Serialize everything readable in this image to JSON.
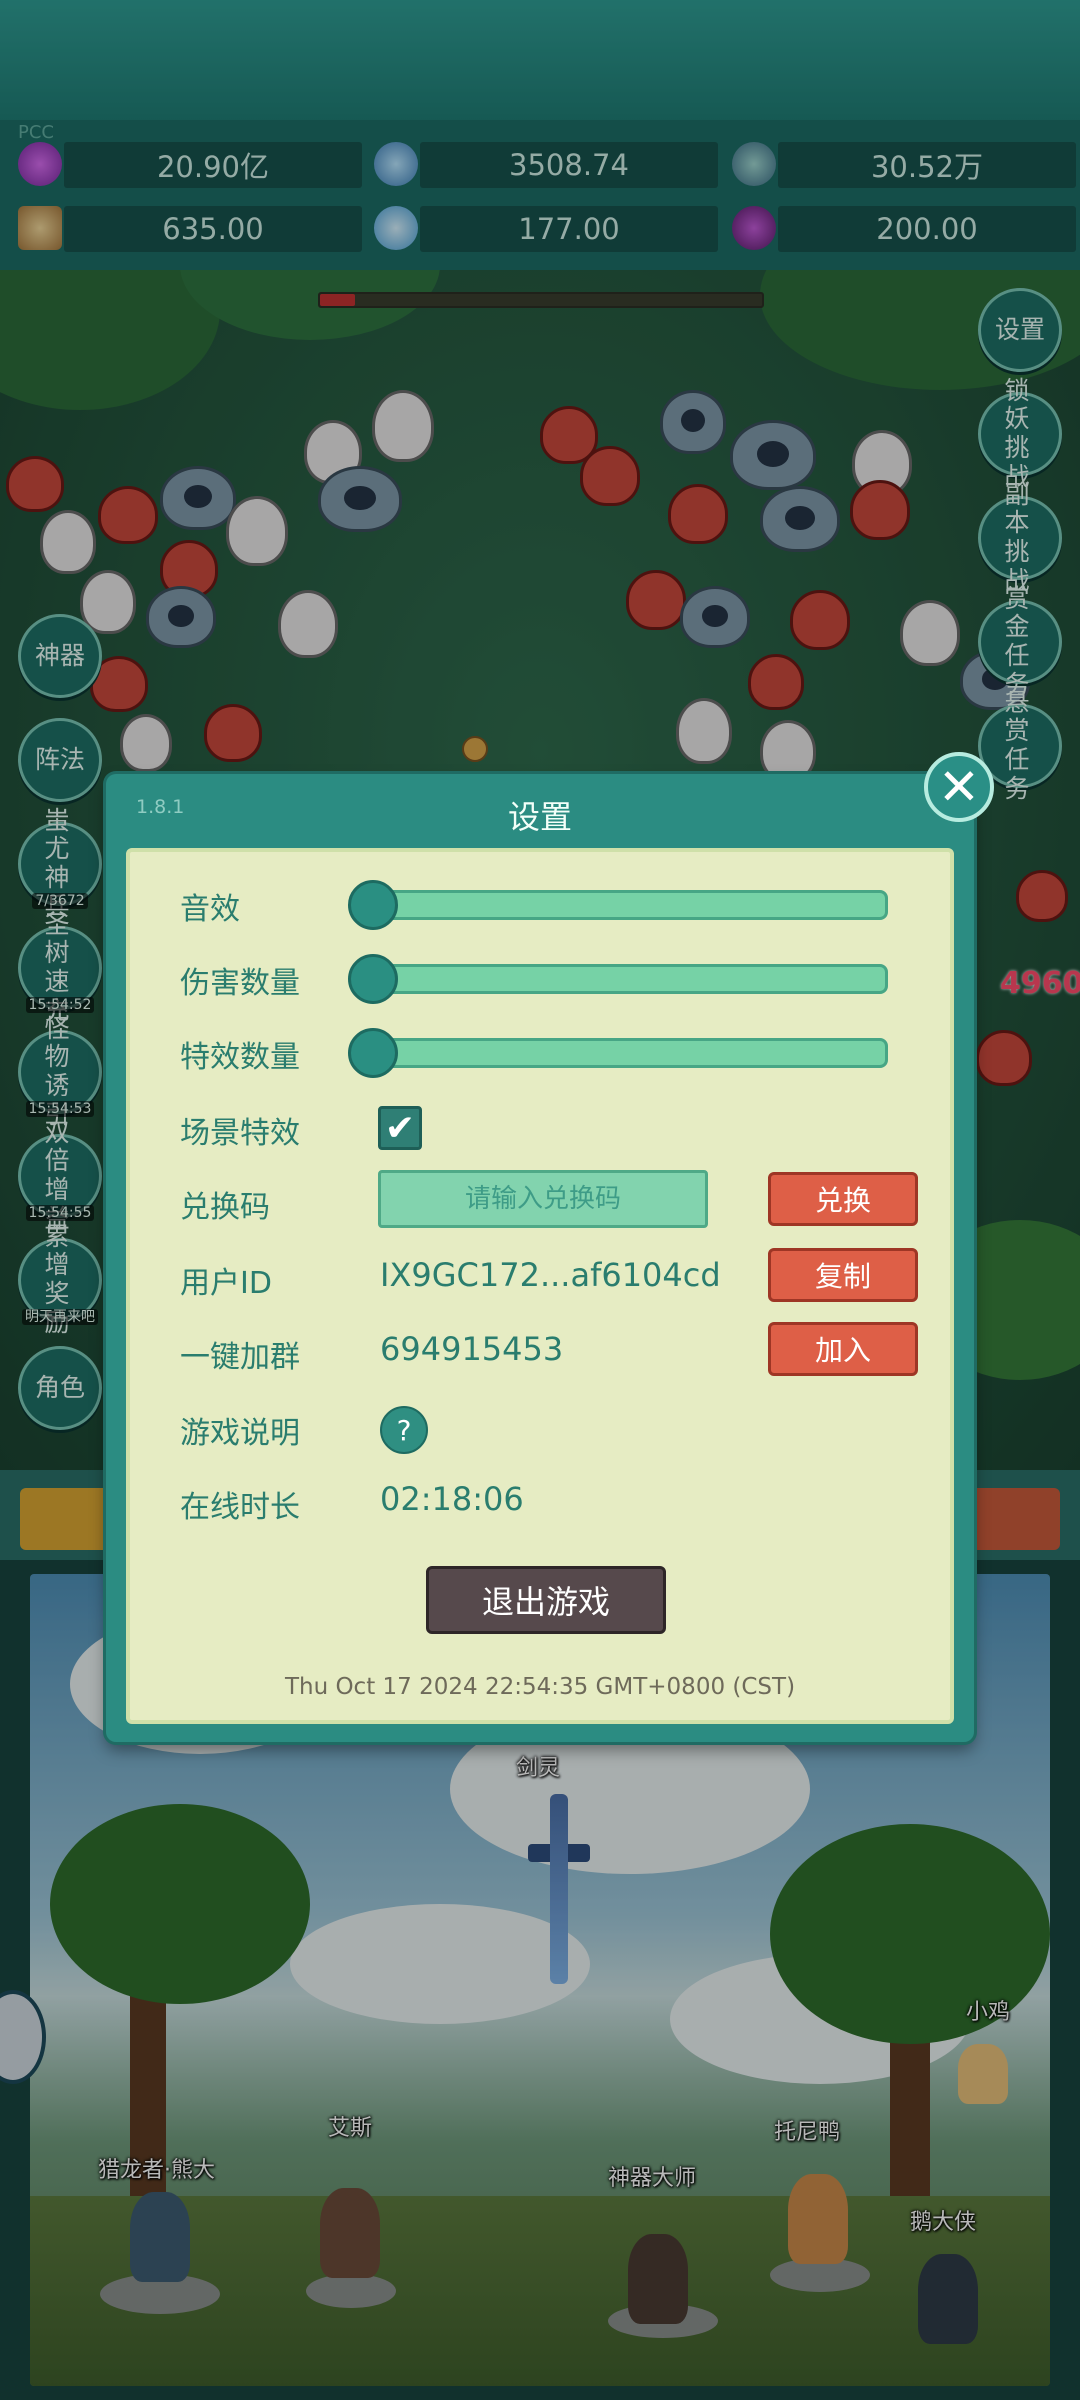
{
  "resources": {
    "label": "PCC",
    "items": [
      {
        "icon": "purple-gem-icon",
        "value": "20.90亿"
      },
      {
        "icon": "blue-crystal-icon",
        "value": "3508.74"
      },
      {
        "icon": "globe-orb-icon",
        "value": "30.52万"
      },
      {
        "icon": "scroll-icon",
        "value": "635.00"
      },
      {
        "icon": "ice-shard-icon",
        "value": "177.00"
      },
      {
        "icon": "potion-icon",
        "value": "200.00"
      }
    ]
  },
  "battle": {
    "boss_hp_fraction": 0.08,
    "damage_popup": "4960"
  },
  "right_menu": [
    {
      "label": "设置"
    },
    {
      "label": "锁妖挑战"
    },
    {
      "label": "副本挑战"
    },
    {
      "label": "赏金任务"
    },
    {
      "label": "悬赏任务"
    }
  ],
  "left_menu": [
    {
      "label": "神器",
      "sub": ""
    },
    {
      "label": "阵法",
      "sub": ""
    },
    {
      "label": "蚩尤神兵",
      "sub": "7/3672"
    },
    {
      "label": "圣树速充",
      "sub": "15:54:52"
    },
    {
      "label": "怪物诱引",
      "sub": "15:54:53"
    },
    {
      "label": "双倍增益",
      "sub": "15:54:55"
    },
    {
      "label": "累增奖励",
      "sub": "明天再来吧"
    },
    {
      "label": "角色",
      "sub": ""
    }
  ],
  "dialog": {
    "version": "1.8.1",
    "title": "设置",
    "sound_label": "音效",
    "sound_level": 0,
    "damage_count_label": "伤害数量",
    "damage_count_level": 0,
    "effect_count_label": "特效数量",
    "effect_count_level": 0,
    "scene_effect_label": "场景特效",
    "scene_effect_checked": "✔",
    "code_label": "兑换码",
    "code_placeholder": "请输入兑换码",
    "redeem_button": "兑换",
    "user_id_label": "用户ID",
    "user_id_value": "IX9GC172...af6104cd",
    "copy_button": "复制",
    "join_group_label": "一键加群",
    "join_group_value": "694915453",
    "join_button": "加入",
    "game_help_label": "游戏说明",
    "help_icon_text": "?",
    "online_label": "在线时长",
    "online_value": "02:18:06",
    "exit_button": "退出游戏",
    "timestamp": "Thu Oct 17 2024 22:54:35 GMT+0800 (CST)",
    "close_icon_text": "✕"
  },
  "scene": {
    "sword_name": "剑灵",
    "characters": [
      {
        "name": "猎龙者·熊大"
      },
      {
        "name": "艾斯"
      },
      {
        "name": "神器大师"
      },
      {
        "name": "托尼鸭"
      },
      {
        "name": "鹅大侠"
      },
      {
        "name": "小鸡"
      }
    ]
  }
}
